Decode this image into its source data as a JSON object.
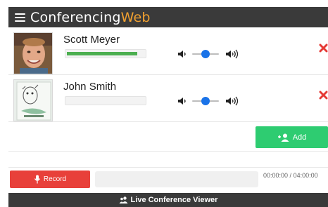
{
  "app": {
    "title_main": "Conferencing",
    "title_accent": "Web"
  },
  "colors": {
    "header_bg": "#3a3a3a",
    "accent": "#f0a030",
    "add": "#2ecc71",
    "record": "#e8403a",
    "remove": "#e53935",
    "level": "#4caf50",
    "slider_knob": "#1a73e8"
  },
  "icons": {
    "menu": "hamburger-icon",
    "volume_low": "volume-low-icon",
    "volume_high": "volume-high-icon",
    "remove": "close-icon",
    "add": "add-user-icon",
    "record": "microphone-icon",
    "viewer": "users-icon"
  },
  "participants": [
    {
      "name": "Scott Meyer",
      "audio_level": 0.93,
      "volume": 0.5
    },
    {
      "name": "John Smith",
      "audio_level": 0,
      "volume": 0.5
    }
  ],
  "actions": {
    "add_label": "Add"
  },
  "recorder": {
    "record_label": "Record",
    "elapsed": "00:00:00",
    "total": "04:00:00",
    "progress": 0
  },
  "footer": {
    "label": "Live Conference Viewer"
  }
}
